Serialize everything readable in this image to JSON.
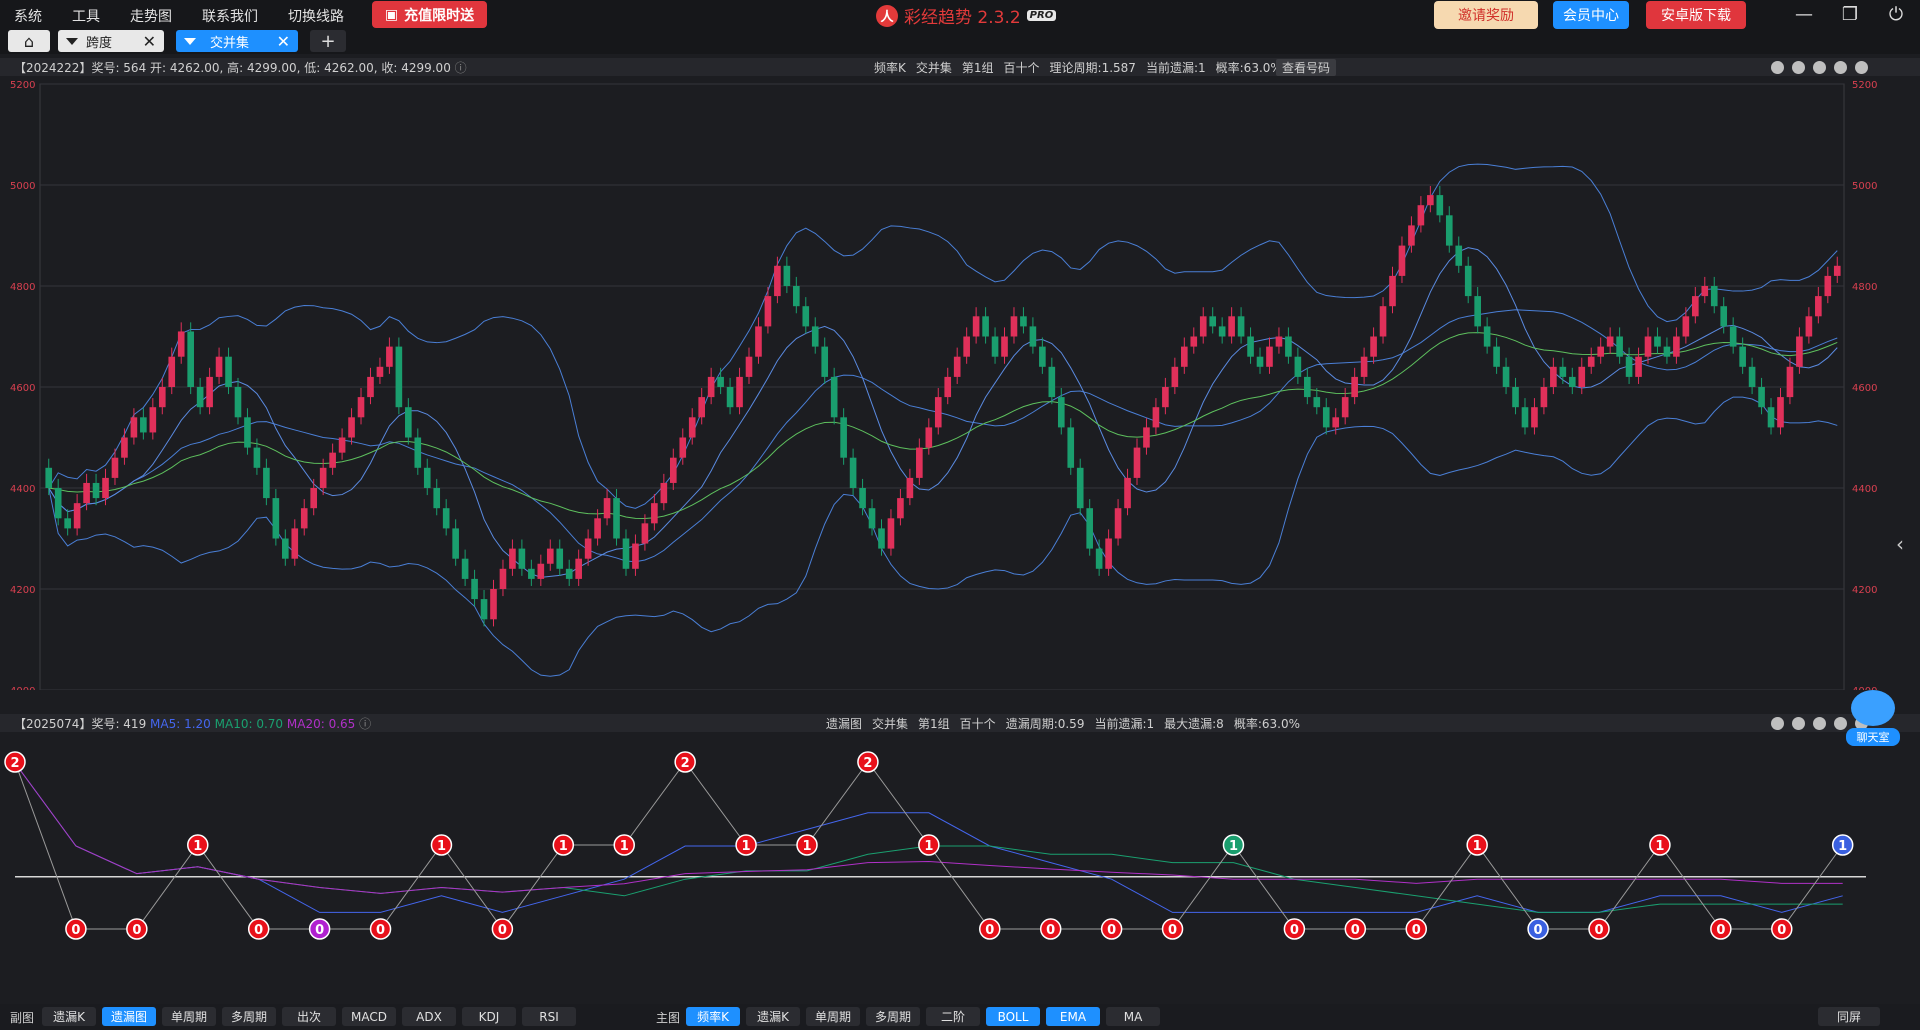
{
  "menu": [
    "系统",
    "工具",
    "走势图",
    "联系我们",
    "切换线路"
  ],
  "promo_label": "充值限时送",
  "brand": {
    "name": "彩经趋势 2.3.2",
    "badge": "PRO"
  },
  "top_buttons": {
    "invite": "邀请奖励",
    "member": "会员中心",
    "android": "安卓版下载"
  },
  "tabs": [
    {
      "label": "跨度"
    },
    {
      "label": "交并集"
    }
  ],
  "main_info": {
    "left": "【2024222】奖号: 564   开: 4262.00, 高: 4299.00, 低: 4262.00, 收: 4299.00",
    "center": [
      "频率K",
      "交并集",
      "第1组",
      "百十个",
      "理论周期:1.587",
      "当前遗漏:1",
      "概率:63.0%"
    ],
    "view_btn": "查看号码"
  },
  "sub_info": {
    "left": "【2025074】奖号: 419",
    "ma5": "MA5: 1.20",
    "ma10": "MA10: 0.70",
    "ma20": "MA20: 0.65",
    "center": [
      "遗漏图",
      "交并集",
      "第1组",
      "百十个",
      "遗漏周期:0.59",
      "当前遗漏:1",
      "最大遗漏:8",
      "概率:63.0%"
    ]
  },
  "colors": {
    "up": "#e0305a",
    "down": "#1a9e6e",
    "boll": "#4a7fd6",
    "ema": "#5ec05e",
    "ma5": "#4466ee",
    "ma10": "#1aa070",
    "ma20": "#b030c8"
  },
  "chart_data": [
    {
      "type": "candlestick",
      "ylim": [
        4000,
        5200
      ],
      "y_ticks": [
        4000,
        4200,
        4400,
        4600,
        4800,
        5000,
        5200
      ],
      "close": [
        4400,
        4340,
        4320,
        4370,
        4410,
        4380,
        4420,
        4460,
        4500,
        4540,
        4510,
        4560,
        4600,
        4660,
        4710,
        4600,
        4560,
        4620,
        4660,
        4600,
        4540,
        4480,
        4440,
        4380,
        4300,
        4260,
        4320,
        4360,
        4400,
        4440,
        4470,
        4500,
        4540,
        4580,
        4620,
        4640,
        4680,
        4560,
        4500,
        4440,
        4400,
        4360,
        4320,
        4260,
        4220,
        4180,
        4140,
        4200,
        4240,
        4280,
        4240,
        4220,
        4250,
        4280,
        4240,
        4220,
        4260,
        4300,
        4340,
        4380,
        4300,
        4240,
        4290,
        4330,
        4370,
        4410,
        4460,
        4500,
        4540,
        4580,
        4620,
        4600,
        4560,
        4620,
        4660,
        4720,
        4780,
        4840,
        4800,
        4760,
        4720,
        4680,
        4620,
        4540,
        4460,
        4400,
        4360,
        4320,
        4280,
        4340,
        4380,
        4420,
        4480,
        4520,
        4580,
        4620,
        4660,
        4700,
        4740,
        4700,
        4660,
        4700,
        4740,
        4720,
        4680,
        4640,
        4580,
        4520,
        4440,
        4360,
        4280,
        4240,
        4300,
        4360,
        4420,
        4480,
        4520,
        4560,
        4600,
        4640,
        4680,
        4700,
        4740,
        4720,
        4700,
        4740,
        4700,
        4660,
        4640,
        4680,
        4700,
        4660,
        4620,
        4580,
        4560,
        4520,
        4540,
        4580,
        4620,
        4660,
        4700,
        4760,
        4820,
        4880,
        4920,
        4960,
        4980,
        4940,
        4880,
        4840,
        4780,
        4720,
        4680,
        4640,
        4600,
        4560,
        4520,
        4560,
        4600,
        4640,
        4620,
        4600,
        4640,
        4660,
        4680,
        4700,
        4660,
        4620,
        4660,
        4700,
        4680,
        4660,
        4700,
        4740,
        4780,
        4800,
        4760,
        4720,
        4680,
        4640,
        4600,
        4560,
        4520,
        4580,
        4640,
        4700,
        4740,
        4780,
        4820,
        4840
      ],
      "series": [
        {
          "name": "BOLL"
        },
        {
          "name": "EMA"
        }
      ]
    },
    {
      "type": "line",
      "miss_values": [
        2,
        0,
        0,
        1,
        0,
        0,
        0,
        1,
        0,
        1,
        1,
        2,
        1,
        1,
        2,
        1,
        0,
        0,
        0,
        0,
        1,
        0,
        0,
        0,
        1,
        0,
        0,
        1,
        0,
        0,
        1
      ],
      "miss_colors": {
        "5": "#b020d0",
        "20": "#1a9e6e",
        "25": "#3a60e0",
        "30": "#3a60e0"
      }
    }
  ],
  "sub_tabs": {
    "label": "副图",
    "items": [
      "遗漏K",
      "遗漏图",
      "单周期",
      "多周期",
      "出次",
      "MACD",
      "ADX",
      "KDJ",
      "RSI"
    ],
    "active": [
      1
    ]
  },
  "main_tabs": {
    "label": "主图",
    "items": [
      "频率K",
      "遗漏K",
      "单周期",
      "多周期",
      "二阶",
      "BOLL",
      "EMA",
      "MA"
    ],
    "active": [
      0,
      5,
      6
    ]
  },
  "fullscreen": "同屏",
  "chat_label": "聊天室"
}
